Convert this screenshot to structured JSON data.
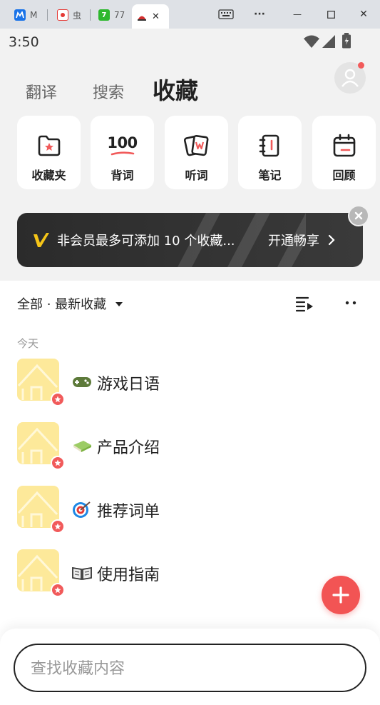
{
  "browser": {
    "tabs": [
      {
        "label": "M",
        "icon": "m-blue-icon",
        "color": "#1a73e8"
      },
      {
        "label": "虫",
        "icon": "red-app-icon",
        "color": "#e53935"
      },
      {
        "label": "77",
        "icon": "seven-green-icon",
        "color": "#2eb82e"
      },
      {
        "label": "",
        "icon": "moji-red-icon",
        "color": "#d32f2f"
      }
    ],
    "close_glyph": "✕",
    "menu_glyph": "···",
    "minimize_glyph": "—",
    "maximize_glyph": "☐",
    "window_close_glyph": "✕"
  },
  "status": {
    "time": "3:50"
  },
  "header": {
    "tabs": [
      "翻译",
      "搜索",
      "收藏"
    ],
    "active_tab": "收藏"
  },
  "tiles": [
    {
      "label": "收藏夹",
      "icon": "favorite-folder-icon"
    },
    {
      "label": "背词",
      "icon": "memorize-100-icon",
      "icon_text": "100"
    },
    {
      "label": "听词",
      "icon": "listen-cards-icon"
    },
    {
      "label": "笔记",
      "icon": "notebook-icon"
    },
    {
      "label": "回顾",
      "icon": "calendar-review-icon"
    }
  ],
  "banner": {
    "text": "非会员最多可添加 10 个收藏...",
    "cta": "开通畅享"
  },
  "filter": {
    "label": "全部 · 最新收藏"
  },
  "section": {
    "label": "今天"
  },
  "items": [
    {
      "title": "游戏日语",
      "emoji": "game-controller-icon"
    },
    {
      "title": "产品介绍",
      "emoji": "green-book-icon"
    },
    {
      "title": "推荐词单",
      "emoji": "target-icon"
    },
    {
      "title": "使用指南",
      "emoji": "open-book-icon"
    }
  ],
  "search": {
    "placeholder": "查找收藏内容"
  },
  "colors": {
    "accent": "#f25454",
    "banner_mark": "#f5c518",
    "thumb": "#fde99a"
  }
}
